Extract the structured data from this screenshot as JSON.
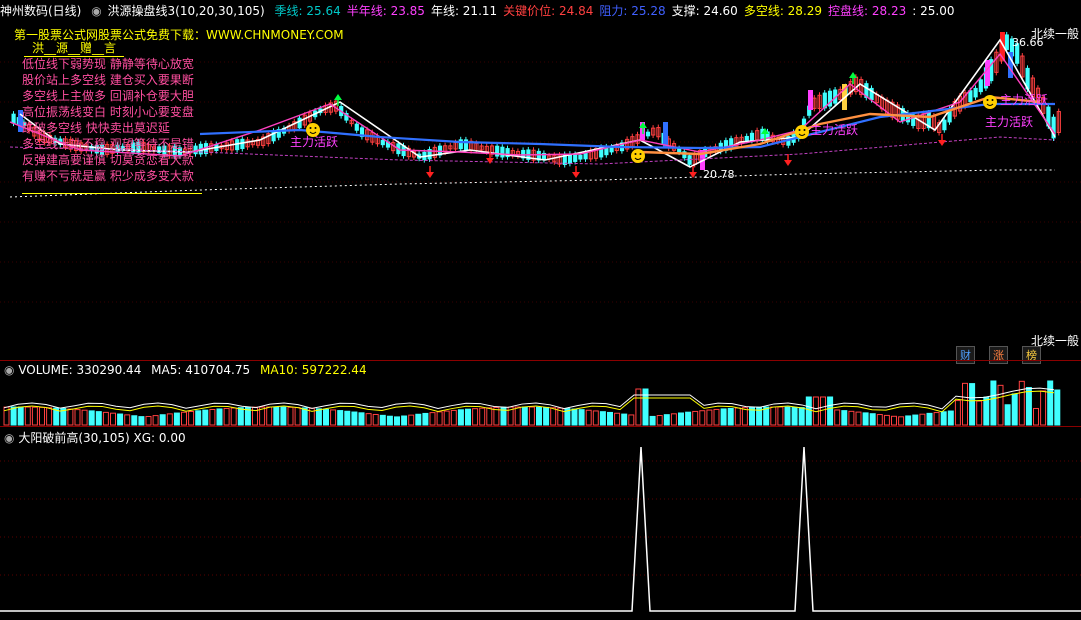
{
  "header": {
    "title": "神州数码(日线)",
    "formula": "洪源操盘线3(10,20,30,105)",
    "items": [
      {
        "label": "季线:",
        "value": "25.64",
        "color": "#00c8c8"
      },
      {
        "label": "半年线:",
        "value": "23.85",
        "color": "#ff40ff"
      },
      {
        "label": "年线:",
        "value": "21.11",
        "color": "#ffffff"
      },
      {
        "label": "关键价位:",
        "value": "24.84",
        "color": "#ff4040"
      },
      {
        "label": "阻力:",
        "value": "25.28",
        "color": "#4060ff"
      },
      {
        "label": "支撑:",
        "value": "24.60",
        "color": "#ffffff"
      },
      {
        "label": "多空线:",
        "value": "28.29",
        "color": "#ffff00"
      },
      {
        "label": "控盘线:",
        "value": "28.23",
        "color": "#ff40ff"
      },
      {
        "label": ":",
        "value": "25.00",
        "color": "#ffffff"
      }
    ]
  },
  "main_panel": {
    "promo": "第一股票公式网股票公式免费下载：WWW.CHNMONEY.COM",
    "poem_title": "洪__源__赠__言",
    "poem_lines": [
      "低位线下弱势现  静静等待心放宽",
      "股价站上多空线  建仓买入要果断",
      "多空线上主做多  回调补仓要大胆",
      "高位振荡线变白  时刻小心要变盘",
      "跌破多空线  快快卖出莫迟延",
      "多空线上站不稳  观望等待不是错",
      "反弹建高要谨慎  切莫贪恋看大款",
      "有赚不亏就是赢  积少成多变大款"
    ],
    "high_label": "36.66",
    "low_label": "20.78",
    "badge_label": "主力活跃",
    "badges": [
      "主力活跃",
      "主力活跃",
      "主力活跃",
      "主力活跃"
    ],
    "right_label_top": "北续一般",
    "right_label_bottom": "北续一般",
    "bottom_tags": [
      {
        "label": "财",
        "color": "#4fa0ff"
      },
      {
        "label": "涨",
        "color": "#ff8040"
      },
      {
        "label": "榜",
        "color": "#ffd040"
      }
    ]
  },
  "volume_panel": {
    "label": "VOLUME:",
    "value": "330290.44",
    "ma5_label": "MA5:",
    "ma5_value": "410704.75",
    "ma10_label": "MA10:",
    "ma10_value": "597222.44"
  },
  "indicator_panel": {
    "label": "大阳破前高(30,105)",
    "xg_label": "XG:",
    "xg_value": "0.00"
  },
  "colors": {
    "up": "#ff4040",
    "down": "#40ffff",
    "ma_pink": "#ff40c0",
    "ma_white": "#ffffff",
    "ma_blue": "#3070ff",
    "ma_orange": "#ff9040",
    "grid": "#8b0000"
  }
}
